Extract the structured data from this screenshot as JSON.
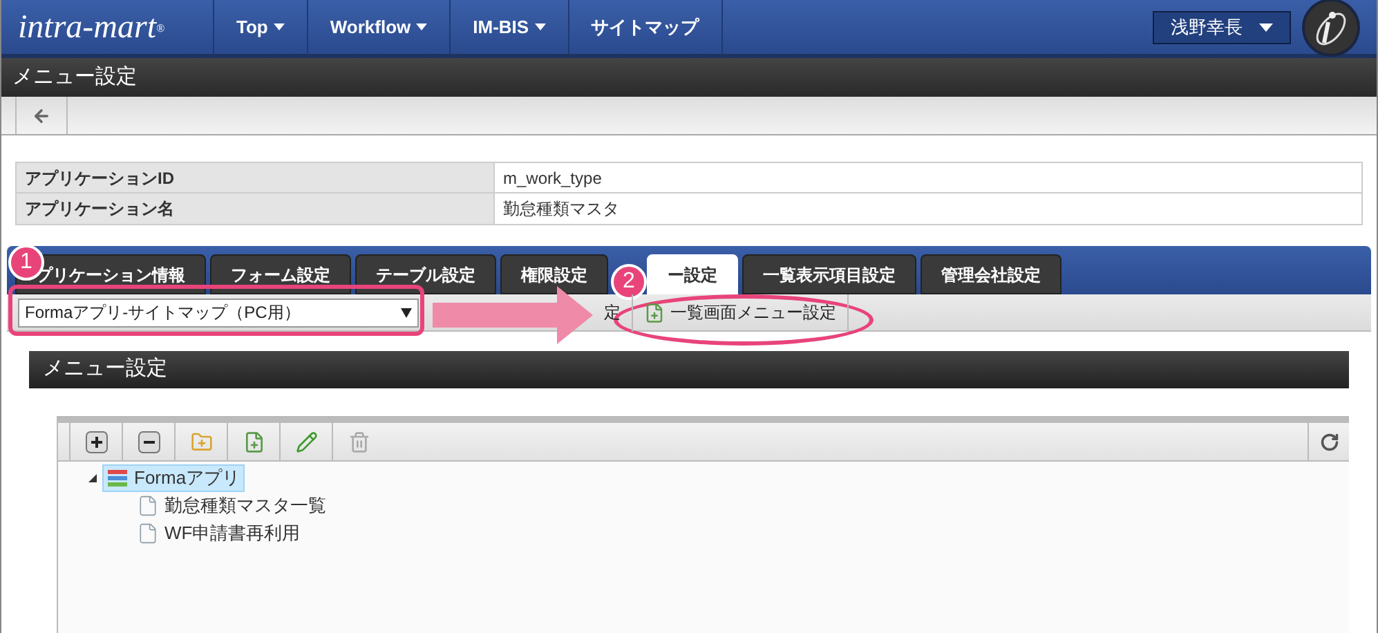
{
  "header": {
    "logo": "intra-mart",
    "logo_mark": "®",
    "nav": [
      {
        "label": "Top",
        "dropdown": true
      },
      {
        "label": "Workflow",
        "dropdown": true
      },
      {
        "label": "IM-BIS",
        "dropdown": true
      },
      {
        "label": "サイトマップ",
        "dropdown": false
      }
    ],
    "user": "浅野幸長"
  },
  "page_title": "メニュー設定",
  "info": [
    {
      "label": "アプリケーションID",
      "value": "m_work_type"
    },
    {
      "label": "アプリケーション名",
      "value": "勤怠種類マスタ"
    }
  ],
  "tabs": [
    {
      "label": "プリケーション情報",
      "selected": false
    },
    {
      "label": "フォーム設定",
      "selected": false
    },
    {
      "label": "テーブル設定",
      "selected": false
    },
    {
      "label": "権限設定",
      "selected": false
    },
    {
      "label": "ー設定",
      "selected": true
    },
    {
      "label": "一覧表示項目設定",
      "selected": false
    },
    {
      "label": "管理会社設定",
      "selected": false
    }
  ],
  "site_select": {
    "value": "Formaアプリ-サイトマップ（PC用）"
  },
  "sub_buttons": [
    {
      "label": "定"
    },
    {
      "label": "一覧画面メニュー設定"
    }
  ],
  "section_title": "メニュー設定",
  "tree": [
    {
      "label": "Formaアプリ",
      "kind": "folder",
      "selected": true,
      "expanded": true,
      "children": [
        {
          "label": "勤怠種類マスタ一覧",
          "kind": "page",
          "selected": false
        },
        {
          "label": "WF申請書再利用",
          "kind": "page",
          "selected": false
        }
      ]
    }
  ],
  "callouts": [
    "1",
    "2"
  ]
}
